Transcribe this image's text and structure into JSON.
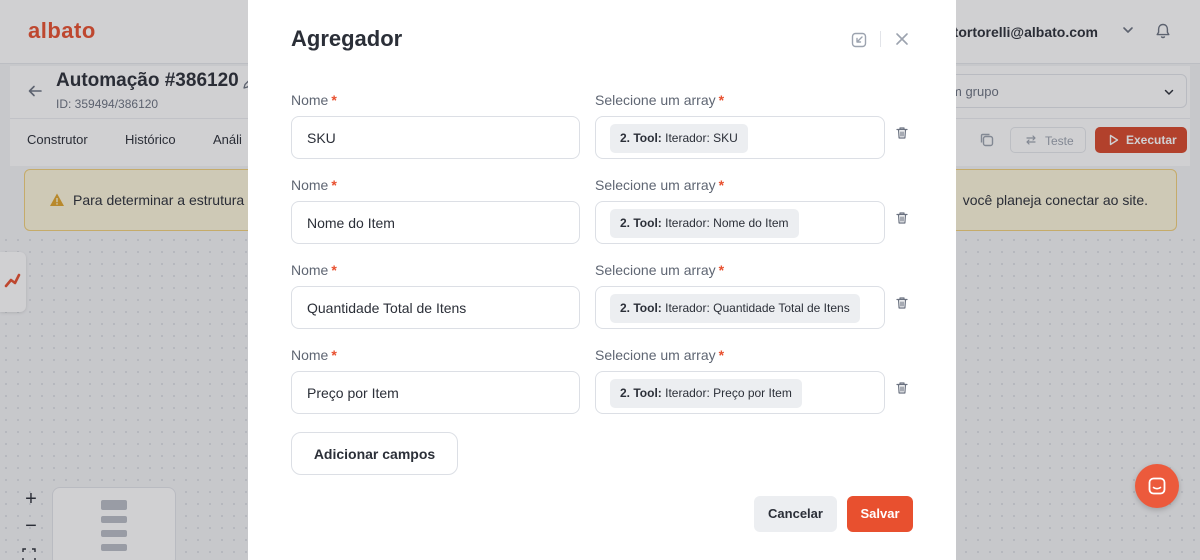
{
  "app": {
    "logo_text": "albato",
    "user_email": ".tortorelli@albato.com"
  },
  "automation": {
    "title": "Automação #386120",
    "id_text": "ID: 359494/386120",
    "group_placeholder": "m grupo"
  },
  "tabs": [
    "Construtor",
    "Histórico",
    "Análi"
  ],
  "toolbar": {
    "test_label": "Teste",
    "run_label": "Executar"
  },
  "warning": {
    "text_left": "Para determinar a estrutura",
    "text_right": "você planeja conectar ao site."
  },
  "canvas_controls": {
    "zoom_in": "+",
    "zoom_out": "−"
  },
  "modal": {
    "title": "Agregador",
    "name_label": "Nome",
    "array_label": "Selecione um array",
    "required_mark": "*",
    "fields": [
      {
        "name": "SKU",
        "array_prefix": "2. Tool:",
        "array_value": "Iterador: SKU"
      },
      {
        "name": "Nome do Item",
        "array_prefix": "2. Tool:",
        "array_value": "Iterador: Nome do Item"
      },
      {
        "name": "Quantidade Total de Itens",
        "array_prefix": "2. Tool:",
        "array_value": "Iterador: Quantidade Total de Itens"
      },
      {
        "name": "Preço por Item",
        "array_prefix": "2. Tool:",
        "array_value": "Iterador: Preço por Item"
      }
    ],
    "add_fields_label": "Adicionar campos",
    "cancel_label": "Cancelar",
    "save_label": "Salvar"
  },
  "colors": {
    "brand": "#e8502f",
    "run_button": "#d9482b",
    "warning_bg": "#fdf6dc",
    "warning_border": "#f1d07a"
  }
}
